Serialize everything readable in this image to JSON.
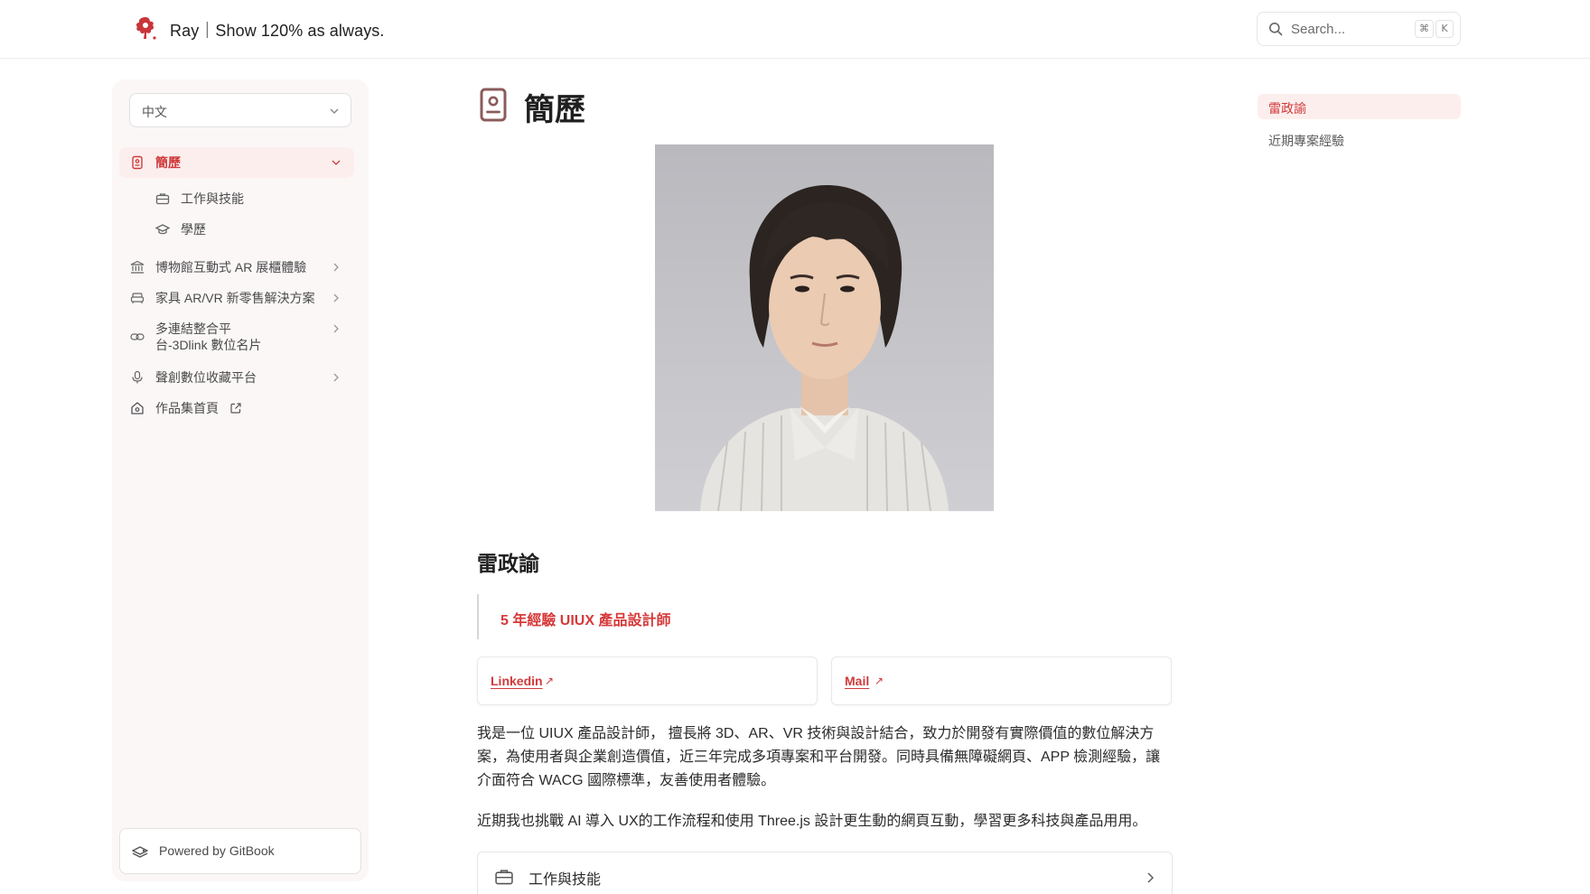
{
  "header": {
    "site_title": "Ray｜Show 120% as always.",
    "search_placeholder": "Search...",
    "shortcut_keys": [
      "⌘",
      "K"
    ]
  },
  "sidebar": {
    "language": "中文",
    "items": [
      {
        "label": "簡歷",
        "icon": "id-badge-icon",
        "active": true
      },
      {
        "label": "工作與技能",
        "icon": "briefcase-icon"
      },
      {
        "label": "學歷",
        "icon": "graduation-cap-icon"
      },
      {
        "label": "博物館互動式 AR 展櫃體驗",
        "icon": "museum-icon"
      },
      {
        "label": "家具 AR/VR 新零售解決方案",
        "icon": "sofa-icon"
      },
      {
        "label_line1": "多連結整合平",
        "label_line2": "台-3Dlink 數位名片",
        "icon": "link-icon"
      },
      {
        "label": "聲創數位收藏平台",
        "icon": "microphone-icon"
      },
      {
        "label": "作品集首頁",
        "icon": "house-icon"
      }
    ],
    "powered_by": "Powered by GitBook"
  },
  "main": {
    "page_title": "簡歷",
    "name_heading": "雷政諭",
    "tagline": "5 年經驗 UIUX 產品設計師",
    "links": [
      {
        "label": "Linkedin"
      },
      {
        "label": "Mail"
      }
    ],
    "para1": "我是一位 UIUX 產品設計師， 擅長將 3D、AR、VR 技術與設計結合，致力於開發有實際價值的數位解決方案，為使用者與企業創造價值，近三年完成多項專案和平台開發。同時具備無障礙網頁、APP 檢測經驗，讓介面符合 WACG 國際標準，友善使用者體驗。",
    "para2": "近期我也挑戰 AI 導入 UX的工作流程和使用 Three.js 設計更生動的網頁互動，學習更多科技與產品用用。",
    "next_card": "工作與技能"
  },
  "toc": {
    "items": [
      {
        "label": "雷政諭",
        "active": true
      },
      {
        "label": "近期專案經驗",
        "active": false
      }
    ]
  },
  "colors": {
    "accent": "#d03a3a",
    "accent_bg": "#fdeeee",
    "sidebar_bg": "#fbf7f7"
  }
}
